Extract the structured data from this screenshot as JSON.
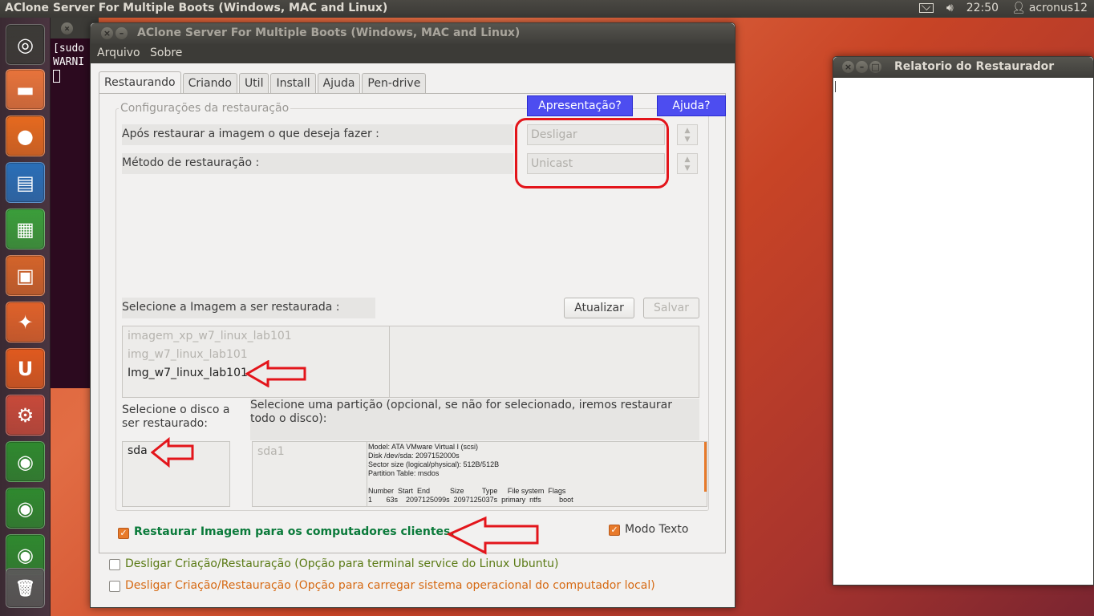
{
  "top_panel": {
    "title": "AClone Server For Multiple Boots (Windows, MAC and Linux)",
    "time": "22:50",
    "user": "acronus12",
    "icons": [
      "mail-icon",
      "volume-icon",
      "user-icon"
    ]
  },
  "launcher": {
    "items": [
      {
        "name": "ubuntu-dash-icon",
        "color": "#3c3b37",
        "glyph": "◎"
      },
      {
        "name": "files-icon",
        "color": "#e8743b",
        "glyph": "▬"
      },
      {
        "name": "firefox-icon",
        "color": "#e66a1f",
        "glyph": "●"
      },
      {
        "name": "writer-icon",
        "color": "#2a6fb8",
        "glyph": "▤"
      },
      {
        "name": "calc-icon",
        "color": "#3b9e3b",
        "glyph": "▦"
      },
      {
        "name": "impress-icon",
        "color": "#d4642a",
        "glyph": "▣"
      },
      {
        "name": "software-center-icon",
        "color": "#e0622a",
        "glyph": "✦"
      },
      {
        "name": "ubuntu-one-icon",
        "color": "#e05a1f",
        "glyph": "U"
      },
      {
        "name": "system-settings-icon",
        "color": "#c84a3a",
        "glyph": "⚙"
      },
      {
        "name": "green-globe-icon-1",
        "color": "#2f8a2f",
        "glyph": "◉"
      },
      {
        "name": "green-globe-icon-2",
        "color": "#2f8a2f",
        "glyph": "◉"
      },
      {
        "name": "green-globe-icon-3",
        "color": "#2f8a2f",
        "glyph": "◉"
      },
      {
        "name": "trash-icon",
        "color": "#5a5a58",
        "glyph": "🗑"
      }
    ]
  },
  "terminal": {
    "lines": [
      "[sudo",
      "WARNI"
    ]
  },
  "main_window": {
    "title": "AClone Server For Multiple Boots (Windows, MAC and Linux)",
    "menu": [
      "Arquivo",
      "Sobre"
    ],
    "tabs": [
      "Restaurando",
      "Criando",
      "Util",
      "Install",
      "Ajuda",
      "Pen-drive"
    ],
    "active_tab": "Restaurando",
    "group_label": "Configurações da restauração",
    "presentation_button": "Apresentação?",
    "help_button": "Ajuda?",
    "after_restore_label": "Após restaurar a imagem o que deseja fazer :",
    "after_restore_value": "Desligar",
    "method_label": "Método de restauração :",
    "method_value": "Unicast",
    "select_image_label": "Selecione a Imagem a ser restaurada :",
    "update_button": "Atualizar",
    "save_button": "Salvar",
    "images": [
      "imagem_xp_w7_linux_lab101",
      "img_w7_linux_lab101",
      "Img_w7_linux_lab101"
    ],
    "selected_image": "Img_w7_linux_lab101",
    "select_disk_label": "Selecione o disco a ser restaurado:",
    "select_partition_label": "Selecione uma partição (opcional, se não for selecionado, iremos restaurar todo o disco):",
    "disks": [
      "sda"
    ],
    "partitions": [
      "sda1"
    ],
    "disk_info": "Model: ATA VMware Virtual I (scsi)\nDisk /dev/sda: 2097152000s\nSector size (logical/physical): 512B/512B\nPartition Table: msdos\n\nNumber  Start  End          Size         Type     File system  Flags\n1       63s    2097125099s  2097125037s  primary  ntfs         boot",
    "restore_clients_label": "Restaurar Imagem para os computadores clientes.",
    "restore_clients_checked": true,
    "text_mode_label": "Modo Texto",
    "text_mode_checked": true,
    "disable_terminal_label": "Desligar Criação/Restauração (Opção para terminal service do Linux Ubuntu)",
    "disable_local_label": "Desligar Criação/Restauração (Opção para carregar sistema operacional do computador local)"
  },
  "report_window": {
    "title": "Relatorio do Restaurador"
  },
  "colors": {
    "accent_blue": "#4d4df0",
    "annotation_red": "#e3151b",
    "checkbox_orange": "#e87a2a",
    "restore_label_green": "#0a7a3a",
    "terminal_option_olive": "#5a7a14",
    "local_option_orange": "#d66a14"
  }
}
